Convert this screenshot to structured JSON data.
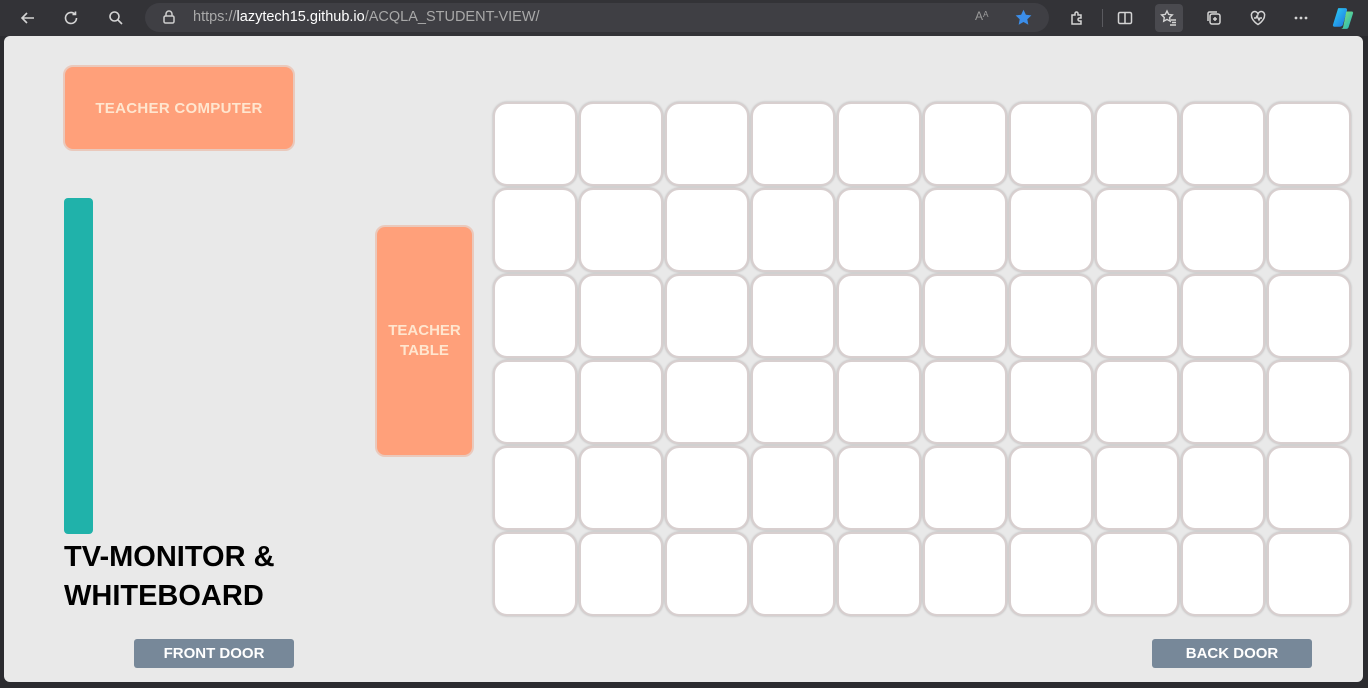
{
  "browser": {
    "url_prefix": "https://",
    "url_host": "lazytech15.github.io",
    "url_path": "/ACQLA_STUDENT-VIEW/",
    "read_aloud_glyph": "Aᴬ",
    "icons": [
      "back-icon",
      "refresh-icon",
      "search-icon",
      "lock-icon",
      "read-aloud-icon",
      "favorite-star-icon",
      "extensions-icon",
      "split-screen-icon",
      "favorites-icon",
      "collections-icon",
      "performance-icon",
      "more-icon",
      "copilot-icon"
    ],
    "accent_star": "#3b8eea"
  },
  "classroom": {
    "teacher_computer": "TEACHER COMPUTER",
    "teacher_table": "TEACHER TABLE",
    "tv_label_line1": "TV-MONITOR &",
    "tv_label_line2": "WHITEBOARD",
    "front_door": "FRONT DOOR",
    "back_door": "BACK DOOR",
    "seat_rows": 6,
    "seat_columns": 10,
    "colors": {
      "desk": "#ffa07a",
      "tv": "#20b2aa",
      "door": "#778899",
      "background": "#e9e9e9",
      "seat": "#ffffff"
    }
  }
}
